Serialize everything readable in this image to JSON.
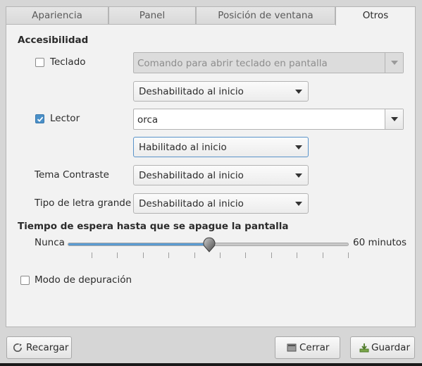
{
  "tabs": [
    "Apariencia",
    "Panel",
    "Posición de ventana",
    "Otros"
  ],
  "active_tab": "Otros",
  "accessibility": {
    "title": "Accesibilidad",
    "keyboard": {
      "label": "Teclado",
      "checked": false,
      "command_placeholder": "Comando para abrir teclado en pantalla",
      "startup": "Deshabilitado al inicio"
    },
    "reader": {
      "label": "Lector",
      "checked": true,
      "command": "orca",
      "startup": "Habilitado al inicio"
    },
    "contrast": {
      "label": "Tema Contraste",
      "value": "Deshabilitado al inicio"
    },
    "large_font": {
      "label": "Tipo de letra grande",
      "value": "Deshabilitado al inicio"
    }
  },
  "screen_timeout": {
    "title": "Tiempo de espera hasta que se apague la pantalla",
    "min_label": "Nunca",
    "max_label": "60 minutos",
    "fraction": 0.5,
    "tick_count": 11
  },
  "debug": {
    "label": "Modo de depuración",
    "checked": false
  },
  "buttons": {
    "reload": "Recargar",
    "close": "Cerrar",
    "save": "Guardar"
  },
  "colors": {
    "accent": "#5b9bd1",
    "check": "#4a90c8"
  }
}
